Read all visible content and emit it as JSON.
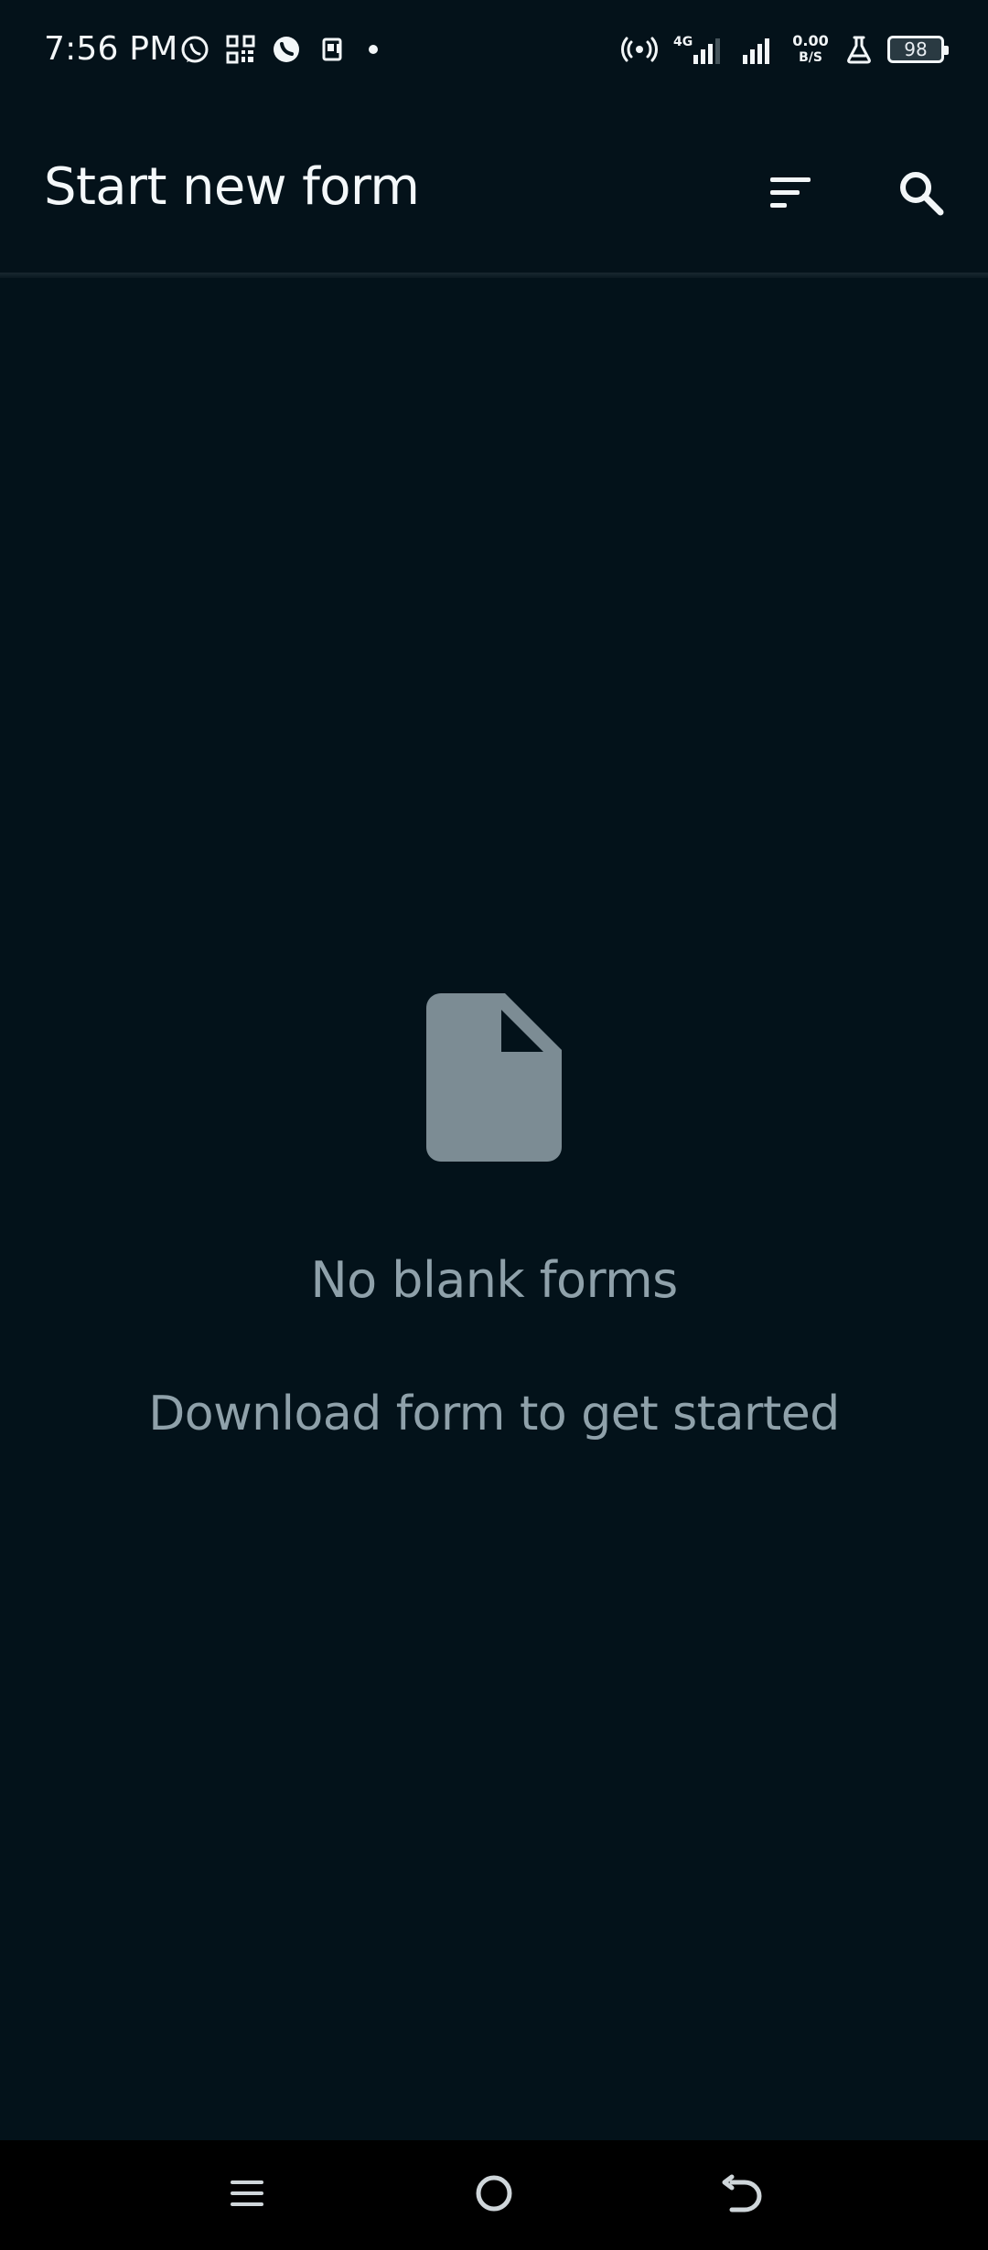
{
  "status_bar": {
    "time": "7:56 PM",
    "left_icons": [
      "whatsapp-icon",
      "qr-code-icon",
      "phone-bubble-icon",
      "app-icon",
      "dot-icon"
    ],
    "right_icons": [
      "hotspot-icon",
      "signal-4g-icon",
      "signal-icon",
      "network-speed-icon",
      "flask-icon",
      "battery-icon"
    ],
    "network": {
      "type": "4G",
      "speed_value": "0.00",
      "speed_unit": "B/S"
    },
    "battery_level": "98"
  },
  "app_bar": {
    "title": "Start new form",
    "actions": [
      {
        "name": "sort",
        "icon": "sort-icon"
      },
      {
        "name": "search",
        "icon": "search-icon"
      }
    ]
  },
  "empty_state": {
    "icon": "document-icon",
    "title": "No blank forms",
    "subtitle": "Download form to get started"
  },
  "navigation_bar": {
    "buttons": [
      {
        "name": "recents",
        "icon": "menu-icon"
      },
      {
        "name": "home",
        "icon": "home-circle-icon"
      },
      {
        "name": "back",
        "icon": "back-icon"
      }
    ]
  },
  "colors": {
    "background": "#03121A",
    "appbar": "#04121A",
    "primary_text": "#F4F8FA",
    "muted_text": "#8FA1AA",
    "empty_icon": "#7C8C94",
    "navbar": "#000000"
  }
}
